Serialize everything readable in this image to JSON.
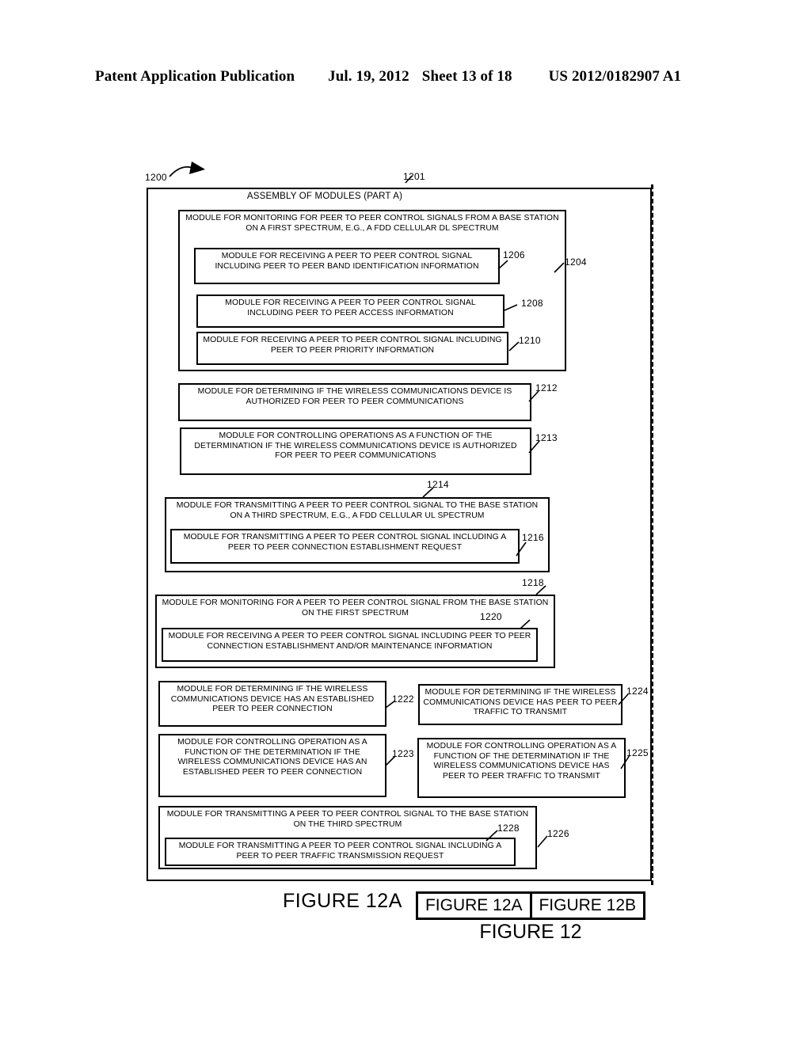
{
  "header": {
    "title": "Patent Application Publication",
    "date": "Jul. 19, 2012",
    "sheet": "Sheet 13 of 18",
    "publication_number": "US 2012/0182907 A1"
  },
  "figure": {
    "assembly_title": "ASSEMBLY OF MODULES (PART A)",
    "refs": {
      "r1200": "1200",
      "r1201": "1201",
      "r1204": "1204",
      "r1206": "1206",
      "r1208": "1208",
      "r1210": "1210",
      "r1212": "1212",
      "r1213": "1213",
      "r1214": "1214",
      "r1216": "1216",
      "r1218": "1218",
      "r1220": "1220",
      "r1222": "1222",
      "r1223": "1223",
      "r1224": "1224",
      "r1225": "1225",
      "r1226": "1226",
      "r1228": "1228"
    },
    "modules": {
      "m1204": "MODULE FOR MONITORING FOR PEER TO PEER CONTROL SIGNALS FROM A BASE STATION ON A FIRST SPECTRUM, E.G., A FDD CELLULAR DL SPECTRUM",
      "m1206": "MODULE FOR RECEIVING A PEER TO PEER CONTROL SIGNAL INCLUDING PEER TO PEER BAND IDENTIFICATION INFORMATION",
      "m1208": "MODULE FOR RECEIVING A PEER TO PEER CONTROL SIGNAL INCLUDING PEER TO PEER ACCESS INFORMATION",
      "m1210": "MODULE FOR RECEIVING A PEER TO PEER CONTROL SIGNAL INCLUDING PEER TO PEER PRIORITY INFORMATION",
      "m1212": "MODULE FOR DETERMINING IF THE WIRELESS COMMUNICATIONS DEVICE IS AUTHORIZED FOR PEER TO PEER COMMUNICATIONS",
      "m1213": "MODULE FOR CONTROLLING OPERATIONS AS A FUNCTION OF THE DETERMINATION IF THE WIRELESS COMMUNICATIONS DEVICE IS AUTHORIZED FOR PEER TO PEER COMMUNICATIONS",
      "m1214": "MODULE FOR TRANSMITTING A PEER TO PEER CONTROL SIGNAL TO THE BASE STATION ON A THIRD SPECTRUM, E.G., A FDD CELLULAR UL SPECTRUM",
      "m1216": "MODULE FOR TRANSMITTING A PEER TO PEER CONTROL SIGNAL INCLUDING A PEER TO PEER CONNECTION ESTABLISHMENT REQUEST",
      "m1218": "MODULE FOR MONITORING FOR A PEER TO PEER CONTROL SIGNAL FROM THE BASE STATION ON THE FIRST SPECTRUM",
      "m1220": "MODULE FOR RECEIVING A PEER TO PEER CONTROL SIGNAL INCLUDING PEER TO PEER CONNECTION ESTABLISHMENT AND/OR MAINTENANCE INFORMATION",
      "m1222": "MODULE FOR DETERMINING IF THE WIRELESS COMMUNICATIONS DEVICE HAS AN ESTABLISHED PEER TO PEER CONNECTION",
      "m1223": "MODULE FOR CONTROLLING OPERATION AS A FUNCTION OF THE DETERMINATION IF THE WIRELESS COMMUNICATIONS DEVICE HAS AN ESTABLISHED PEER TO PEER CONNECTION",
      "m1224": "MODULE FOR DETERMINING IF THE WIRELESS COMMUNICATIONS DEVICE HAS PEER TO PEER TRAFFIC TO TRANSMIT",
      "m1225": "MODULE FOR CONTROLLING OPERATION AS A FUNCTION OF THE DETERMINATION IF THE WIRELESS COMMUNICATIONS DEVICE HAS PEER TO PEER TRAFFIC TO TRANSMIT",
      "m1226": "MODULE FOR TRANSMITTING A PEER TO PEER CONTROL SIGNAL TO THE BASE STATION ON THE THIRD SPECTRUM",
      "m1228": "MODULE FOR TRANSMITTING A PEER TO PEER CONTROL SIGNAL INCLUDING A PEER TO PEER TRAFFIC TRANSMISSION REQUEST"
    }
  },
  "captions": {
    "figure_12a": "FIGURE 12A",
    "key_left": "FIGURE 12A",
    "key_right": "FIGURE 12B",
    "figure_12": "FIGURE 12"
  }
}
